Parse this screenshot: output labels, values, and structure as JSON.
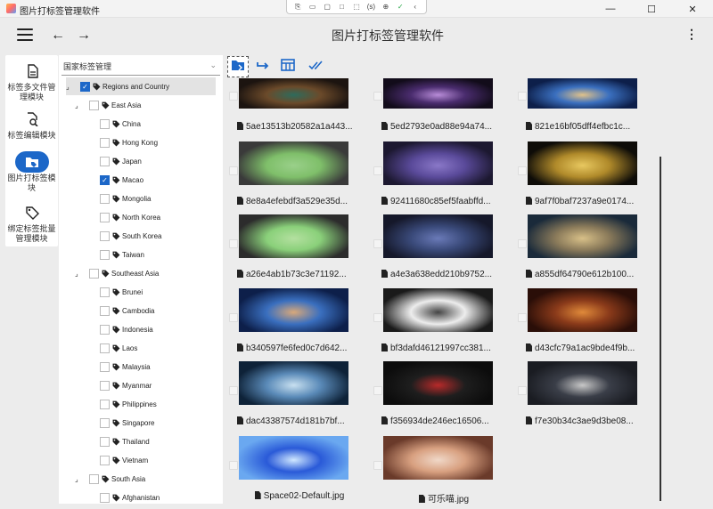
{
  "window": {
    "title": "图片打标签管理软件",
    "controls": [
      "—",
      "☐",
      "✕"
    ]
  },
  "recorder_toolbar": [
    "⎘",
    "▭",
    "▢",
    "□",
    "⬚",
    "(s)",
    "⊕",
    "✓",
    "‹"
  ],
  "appbar": {
    "title": "图片打标签管理软件",
    "menu_icon": "hamburger-menu-icon",
    "back_icon": "arrow-left-icon",
    "forward_icon": "arrow-right-icon",
    "more_icon": "more-vert-icon",
    "back_glyph": "←",
    "forward_glyph": "→",
    "more_glyph": "⋮"
  },
  "rail": [
    {
      "label": "标签多文件管理模块",
      "icon": "file-document-icon",
      "active": false
    },
    {
      "label": "标签编辑模块",
      "icon": "file-search-icon",
      "active": false
    },
    {
      "label": "图片打标签模块",
      "icon": "tag-folder-icon",
      "active": true
    },
    {
      "label": "绑定标签批量管理模块",
      "icon": "tag-icon",
      "active": false
    }
  ],
  "tree": {
    "dropdown_value": "国家标签管理",
    "nodes": [
      {
        "label": "Regions and Country",
        "level": 0,
        "expandable": true,
        "checked": true,
        "selected": true
      },
      {
        "label": "East Asia",
        "level": 1,
        "expandable": true,
        "checked": false
      },
      {
        "label": "China",
        "level": 2,
        "checked": false
      },
      {
        "label": "Hong Kong",
        "level": 2,
        "checked": false
      },
      {
        "label": "Japan",
        "level": 2,
        "checked": false
      },
      {
        "label": "Macao",
        "level": 2,
        "checked": true
      },
      {
        "label": "Mongolia",
        "level": 2,
        "checked": false
      },
      {
        "label": "North Korea",
        "level": 2,
        "checked": false
      },
      {
        "label": "South Korea",
        "level": 2,
        "checked": false
      },
      {
        "label": "Taiwan",
        "level": 2,
        "checked": false
      },
      {
        "label": "Southeast Asia",
        "level": 1,
        "expandable": true,
        "checked": false
      },
      {
        "label": "Brunei",
        "level": 2,
        "checked": false
      },
      {
        "label": "Cambodia",
        "level": 2,
        "checked": false
      },
      {
        "label": "Indonesia",
        "level": 2,
        "checked": false
      },
      {
        "label": "Laos",
        "level": 2,
        "checked": false
      },
      {
        "label": "Malaysia",
        "level": 2,
        "checked": false
      },
      {
        "label": "Myanmar",
        "level": 2,
        "checked": false
      },
      {
        "label": "Philippines",
        "level": 2,
        "checked": false
      },
      {
        "label": "Singapore",
        "level": 2,
        "checked": false
      },
      {
        "label": "Thailand",
        "level": 2,
        "checked": false
      },
      {
        "label": "Vietnam",
        "level": 2,
        "checked": false
      },
      {
        "label": "South Asia",
        "level": 1,
        "expandable": true,
        "checked": false
      },
      {
        "label": "Afghanistan",
        "level": 2,
        "checked": false
      }
    ]
  },
  "toolbar": [
    {
      "name": "open-folder-button",
      "icon": "folder-open-icon",
      "active": true
    },
    {
      "name": "move-button",
      "icon": "subdirectory-arrow-icon",
      "active": false
    },
    {
      "name": "table-view-button",
      "icon": "table-icon",
      "active": false
    },
    {
      "name": "select-all-button",
      "icon": "double-check-icon",
      "active": false
    }
  ],
  "gallery": [
    {
      "caption": "5ae13513b20582a1a443...",
      "colors": [
        "#1c1410",
        "#6b4a2a",
        "#2e6b5c"
      ]
    },
    {
      "caption": "5ed2793e0ad88e94a74...",
      "colors": [
        "#120c1a",
        "#4a2c6e",
        "#b88cd8"
      ]
    },
    {
      "caption": "821e16bf05dff4efbc1c...",
      "colors": [
        "#0d1f4a",
        "#3a6fbf",
        "#e0c28a"
      ]
    },
    {
      "caption": "8e8a4efebdf3a529e35d...",
      "colors": [
        "#3a3a3a",
        "#7fbf6a",
        "#9ad08a"
      ]
    },
    {
      "caption": "92411680c85ef5faabffd...",
      "colors": [
        "#1c1830",
        "#5a4a9a",
        "#8a78c8"
      ]
    },
    {
      "caption": "9af7f0baf7237a9e0174...",
      "colors": [
        "#0e0c08",
        "#b08a2a",
        "#e8c860"
      ]
    },
    {
      "caption": "a26e4ab1b73c3e71192...",
      "colors": [
        "#2c2c2c",
        "#8ad07a",
        "#b4e0a0"
      ]
    },
    {
      "caption": "a4e3a638edd210b9752...",
      "colors": [
        "#15182a",
        "#3a4a7a",
        "#6a7ab8"
      ]
    },
    {
      "caption": "a855df64790e612b100...",
      "colors": [
        "#1a2a3a",
        "#8a7a5a",
        "#d8c088"
      ]
    },
    {
      "caption": "b340597fe6fed0c7d642...",
      "colors": [
        "#0d1f4a",
        "#3a6fbf",
        "#d8a87a"
      ]
    },
    {
      "caption": "bf3dafd46121997cc381...",
      "colors": [
        "#1a1a1a",
        "#ededed",
        "#444444"
      ]
    },
    {
      "caption": "d43cfc79a1ac9bde4f9b...",
      "colors": [
        "#2a0e08",
        "#8a3a1a",
        "#e08a3a"
      ]
    },
    {
      "caption": "dac43387574d181b7bf...",
      "colors": [
        "#0e2238",
        "#5a8ab8",
        "#c8e0f0"
      ]
    },
    {
      "caption": "f356934de246ec16506...",
      "colors": [
        "#0c0c0c",
        "#1e1e1e",
        "#b82a2a"
      ]
    },
    {
      "caption": "f7e30b34c3ae9d3be08...",
      "colors": [
        "#1a1c22",
        "#3a3e48",
        "#c8c8c8"
      ]
    },
    {
      "caption": "Space02-Default.jpg",
      "colors": [
        "#6aa8f0",
        "#2a5ad8",
        "#d0e8ff"
      ]
    },
    {
      "caption": "可乐喵.jpg",
      "colors": [
        "#6a3a2a",
        "#d8a080",
        "#f0d8c8"
      ]
    }
  ]
}
